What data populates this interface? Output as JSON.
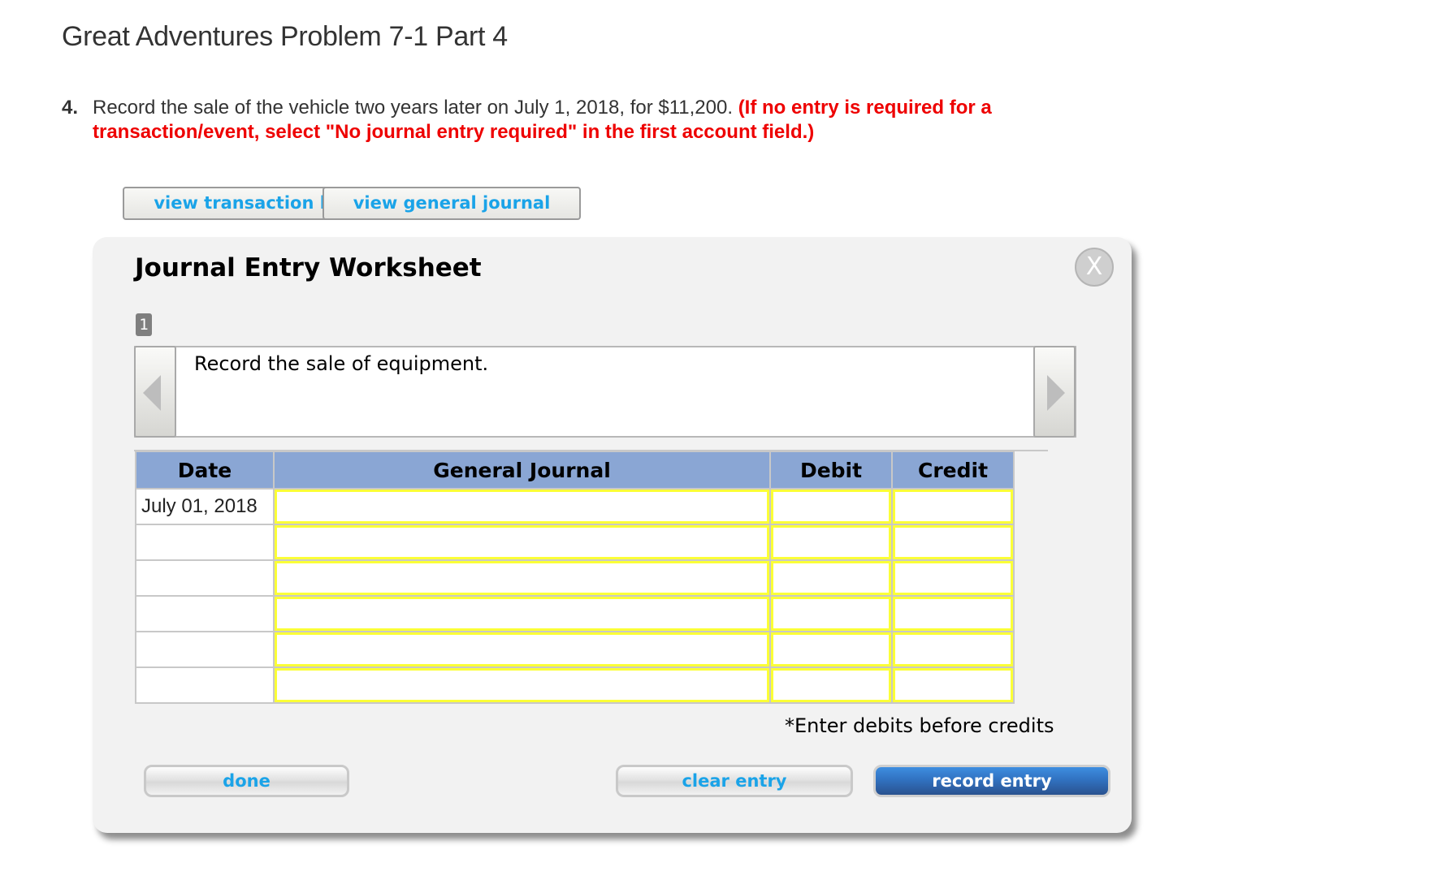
{
  "page": {
    "title": "Great Adventures Problem 7-1 Part 4"
  },
  "question": {
    "number": "4.",
    "text": "Record the sale of the vehicle two years later on July 1, 2018, for $11,200.",
    "hint": "(If no entry is required for a transaction/event, select \"No journal entry required\" in the first account field.)"
  },
  "top_buttons": {
    "view_transaction_list": "view transaction list",
    "view_general_journal": "view general journal"
  },
  "worksheet": {
    "title": "Journal Entry Worksheet",
    "close_label": "X",
    "close_icon": "close-icon",
    "current_step": "1",
    "description": "Record the sale of equipment.",
    "prev_icon": "triangle-left-icon",
    "next_icon": "triangle-right-icon",
    "table": {
      "headers": [
        "Date",
        "General Journal",
        "Debit",
        "Credit"
      ],
      "rows": [
        {
          "date": "July 01, 2018",
          "account": "",
          "debit": "",
          "credit": ""
        },
        {
          "date": "",
          "account": "",
          "debit": "",
          "credit": ""
        },
        {
          "date": "",
          "account": "",
          "debit": "",
          "credit": ""
        },
        {
          "date": "",
          "account": "",
          "debit": "",
          "credit": ""
        },
        {
          "date": "",
          "account": "",
          "debit": "",
          "credit": ""
        },
        {
          "date": "",
          "account": "",
          "debit": "",
          "credit": ""
        }
      ]
    },
    "note": "*Enter debits before credits",
    "buttons": {
      "done": "done",
      "clear_entry": "clear entry",
      "record_entry": "record entry"
    }
  },
  "colors": {
    "link_blue": "#1aa3e8",
    "hint_red": "#ee0000",
    "header_blue": "#8aa6d4",
    "input_border_yellow": "#fbff37",
    "record_button_blue": "#3172c1",
    "panel_bg": "#f2f2f2"
  }
}
